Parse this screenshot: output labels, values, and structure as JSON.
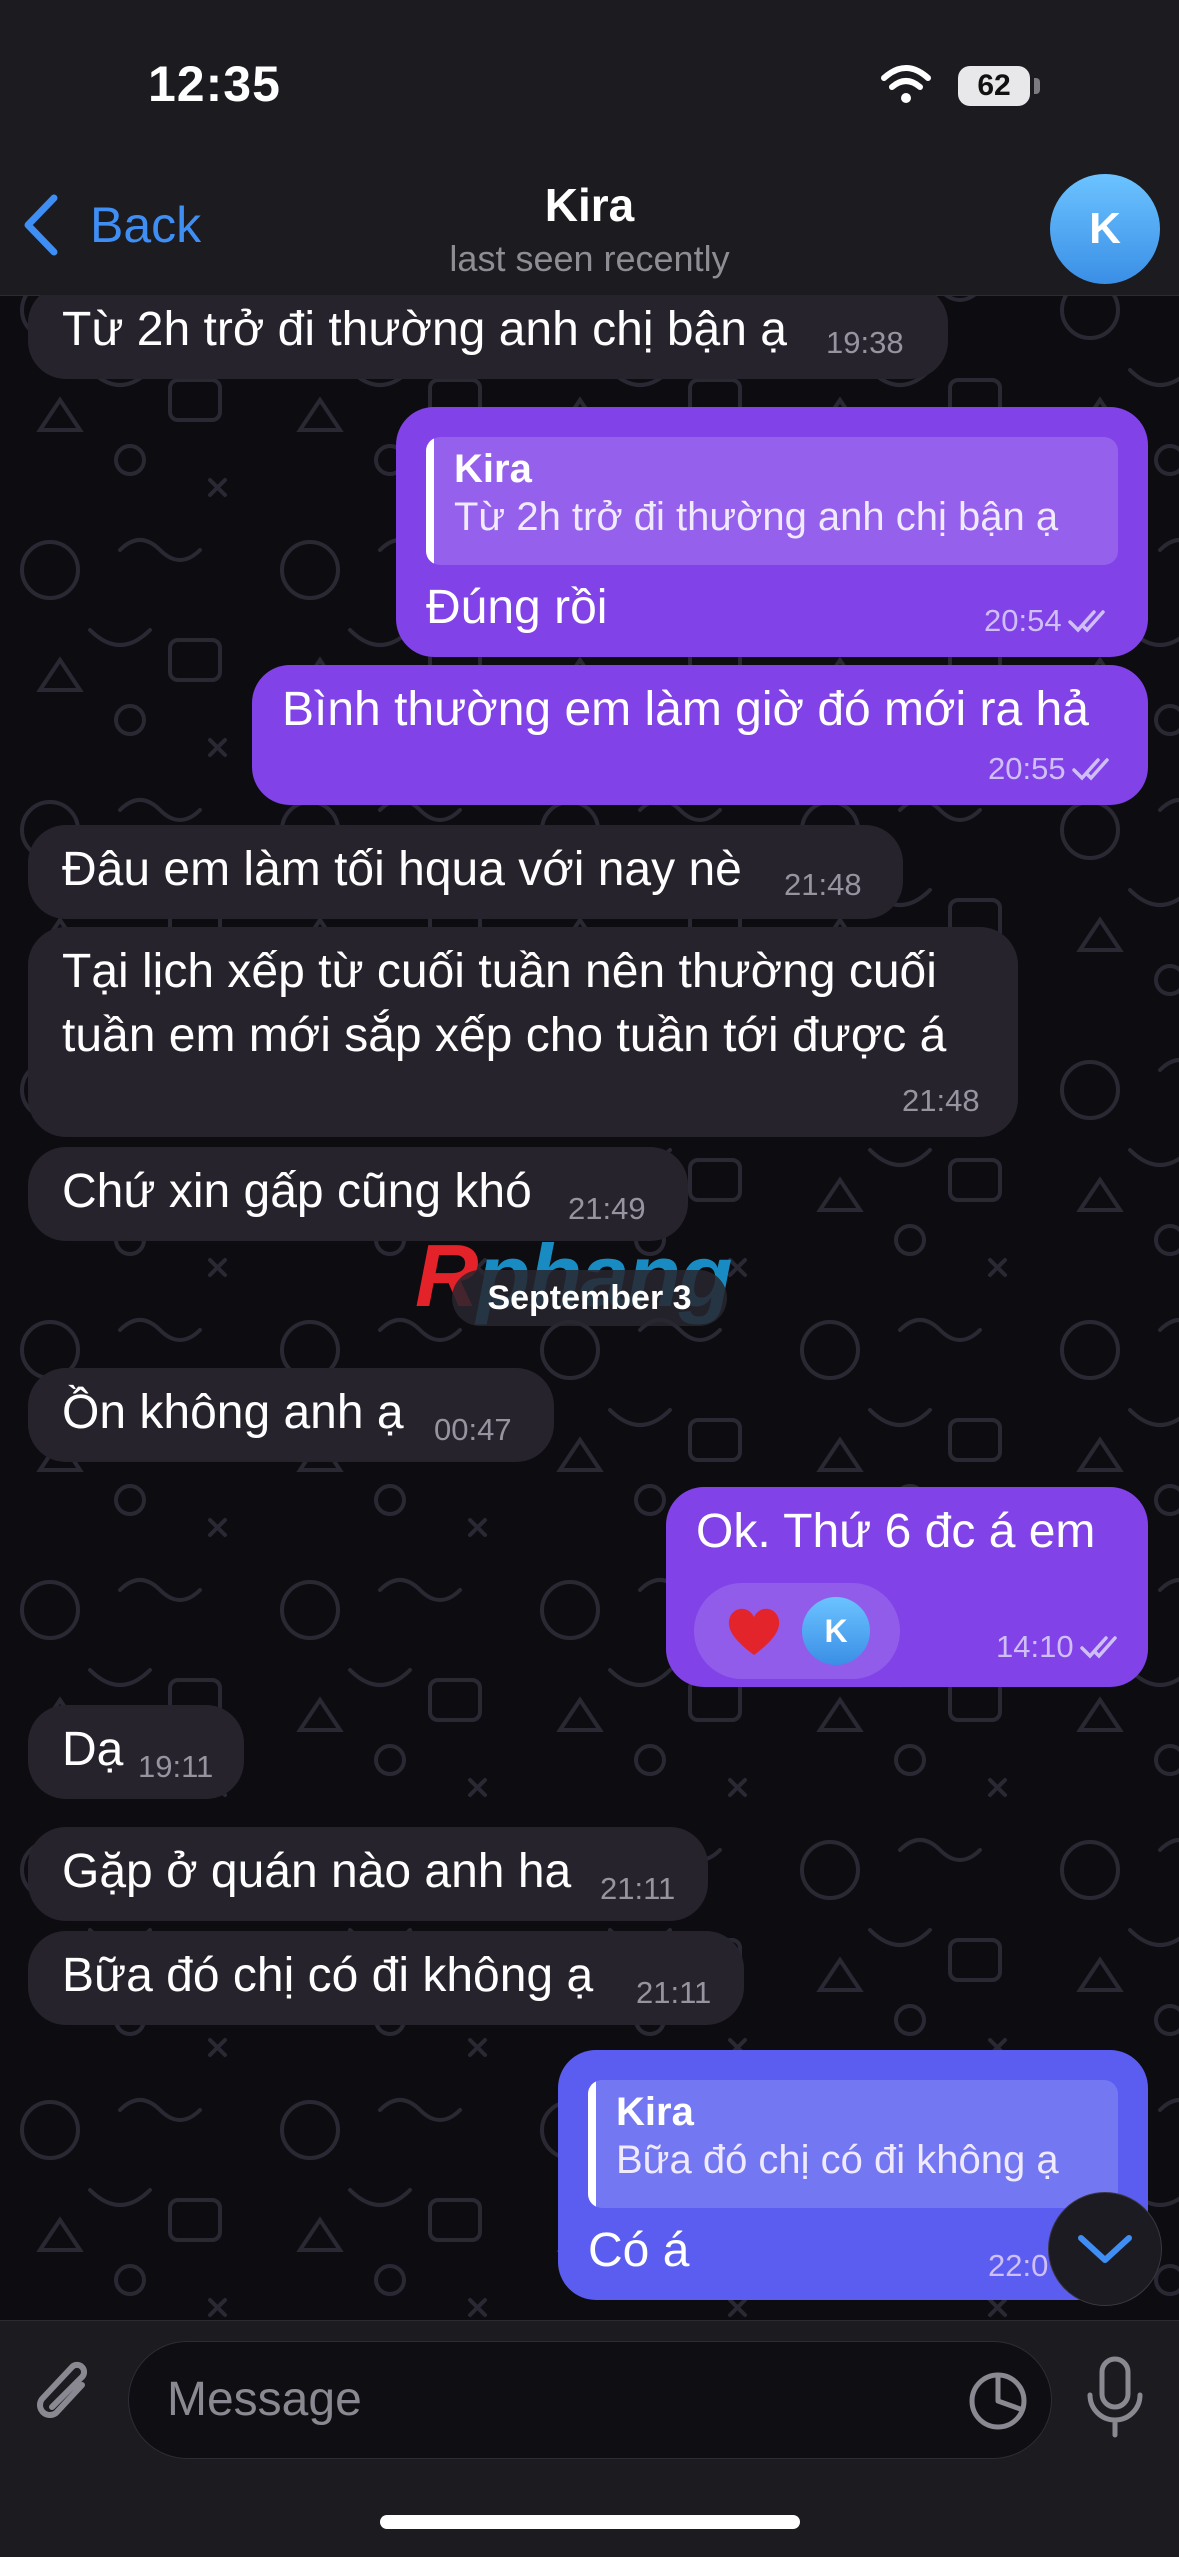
{
  "status_bar": {
    "time": "12:35",
    "battery": "62"
  },
  "header": {
    "back_label": "Back",
    "title": "Kira",
    "subtitle": "last seen recently",
    "avatar_initial": "K"
  },
  "date_separator": "September 3",
  "watermark": {
    "part1": "R",
    "part2": "phang"
  },
  "messages": [
    {
      "dir": "in",
      "text": "Từ 2h trở đi thường anh chị bận ạ",
      "time": "19:38"
    },
    {
      "dir": "out",
      "reply_name": "Kira",
      "reply_text": "Từ 2h trở đi thường anh chị bận ạ",
      "text": "Đúng rồi",
      "time": "20:54"
    },
    {
      "dir": "out",
      "text": "Bình thường em làm giờ đó mới ra hả",
      "time": "20:55"
    },
    {
      "dir": "in",
      "text": "Đâu em làm tối hqua với nay nè",
      "time": "21:48"
    },
    {
      "dir": "in",
      "text_lines": [
        "Tại lịch xếp từ cuối tuần nên thường cuối",
        "tuần em mới sắp xếp cho tuần tới được á"
      ],
      "time": "21:48"
    },
    {
      "dir": "in",
      "text": "Chứ xin gấp cũng khó",
      "time": "21:49"
    },
    {
      "dir": "in",
      "text": "Ồn không anh ạ",
      "time": "00:47"
    },
    {
      "dir": "out",
      "text": "Ok. Thứ 6 đc á em",
      "time": "14:10",
      "reaction": {
        "emoji": "heart-icon",
        "avatar_initial": "K"
      }
    },
    {
      "dir": "in",
      "text": "Dạ",
      "time": "19:11"
    },
    {
      "dir": "in",
      "text": "Gặp ở quán nào anh ha",
      "time": "21:11"
    },
    {
      "dir": "in",
      "text": "Bữa đó chị có đi không ạ",
      "time": "21:11"
    },
    {
      "dir": "out",
      "reply_name": "Kira",
      "reply_text": "Bữa đó chị có đi không ạ",
      "text": "Có á",
      "time": "22:0"
    }
  ],
  "input": {
    "placeholder": "Message"
  },
  "colors": {
    "accent": "#3e8ef4",
    "outgoing": "#8142e8",
    "incoming": "#27232d",
    "background": "#0d0c10"
  }
}
